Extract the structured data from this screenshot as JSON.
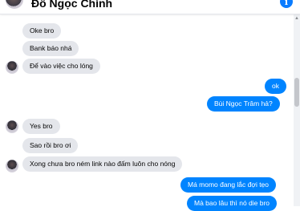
{
  "header": {
    "contact_name": "Đỗ Ngọc Chính",
    "info_icon": "info-icon",
    "info_glyph": "i"
  },
  "messages": [
    {
      "dir": "in",
      "text": "Oke bro"
    },
    {
      "dir": "in",
      "text": "Bank báo nhá"
    },
    {
      "dir": "in",
      "text": "Để vào việc cho lóng"
    },
    {
      "dir": "out",
      "text": "ok"
    },
    {
      "dir": "out",
      "text": "Bùi Ngọc Trâm hả?"
    },
    {
      "dir": "in",
      "text": "Yes bro"
    },
    {
      "dir": "in",
      "text": "Sao rồi bro ơi"
    },
    {
      "dir": "in",
      "text": "Xong chưa bro ném link nào đấm luôn cho nóng"
    },
    {
      "dir": "out",
      "text": "Má momo đang lắc đợi tẹo"
    },
    {
      "dir": "out",
      "text": "Mà bao lâu thì nó die bro"
    }
  ],
  "colors": {
    "outgoing_bubble": "#0084ff",
    "incoming_bubble": "#e4e6eb",
    "accent": "#0a7cff"
  }
}
